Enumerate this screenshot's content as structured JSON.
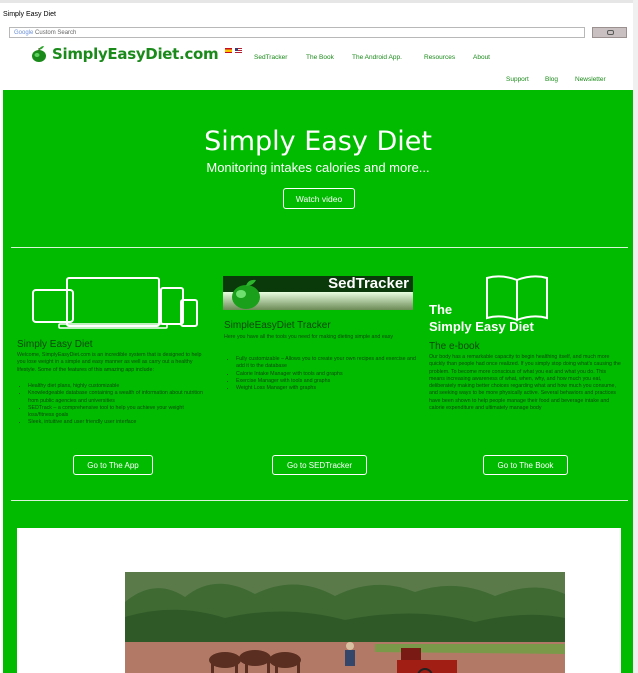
{
  "window": {
    "title": "Simply Easy Diet"
  },
  "search": {
    "brand": "Google",
    "placeholder": "Custom Search"
  },
  "logo": {
    "text": "SimplyEasyDiet.com"
  },
  "nav": {
    "items": [
      "SedTracker",
      "The Book",
      "The Android App.",
      "Resources",
      "About"
    ]
  },
  "subnav": {
    "items": [
      "Support",
      "Blog",
      "Newsletter"
    ]
  },
  "hero": {
    "title": "Simply Easy Diet",
    "subtitle": "Monitoring intakes calories and more...",
    "button": "Watch video"
  },
  "col1": {
    "heading": "Simply Easy Diet",
    "text": "Welcome, SimplyEasyDiet.com is an incredible system that is designed to help you lose weight in a simple and easy manner as well as carry out a healthy lifestyle. Some of the features of this amazing app include:",
    "bullets": [
      "Healthy diet plans, highly customizable",
      "Knowledgeable database containing a wealth of information about nutrition from public agencies and universities",
      "SEDTrack – a comprehensive tool to help you achieve your weight loss/fitness goals",
      "Sleek, intuitive and user friendly user interface"
    ],
    "button": "Go to The App"
  },
  "col2": {
    "banner": "SedTracker",
    "heading": "SimpleEasyDiet Tracker",
    "text": "Here you have all the tools you need for making dieting simple and easy",
    "bullets": [
      "Fully customizable – Allows you to create your own recipes and exercise and add it to the database",
      "Calorie Intake Manager with tools and graphs",
      "Exercise Manager with tools and graphs",
      "Weight Loss Manager with graphs"
    ],
    "button": "Go to SEDTracker"
  },
  "col3": {
    "book_line1": "The",
    "book_line2": "Simply Easy Diet",
    "heading": "The e-book",
    "text": "Our body has a remarkable capacity to begin healthing itself, and much more quickly than people had once realized. If you simply stop doing what's causing the problem. To become more conscious of what you eat and what you do. This means increasing awareness of what, when, why, and how much you eat, deliberately making better choices regarding what and how much you consume, and seeking ways to be more physically active. Several behaviors and practices have been shown to help people manage their food and beverage intake and calorie expenditure and ultimately manage body",
    "button": "Go to The Book"
  },
  "colors": {
    "green": "#00bb00",
    "dark_text": "#0b4a0b",
    "logo_green": "#1a8a1a"
  }
}
